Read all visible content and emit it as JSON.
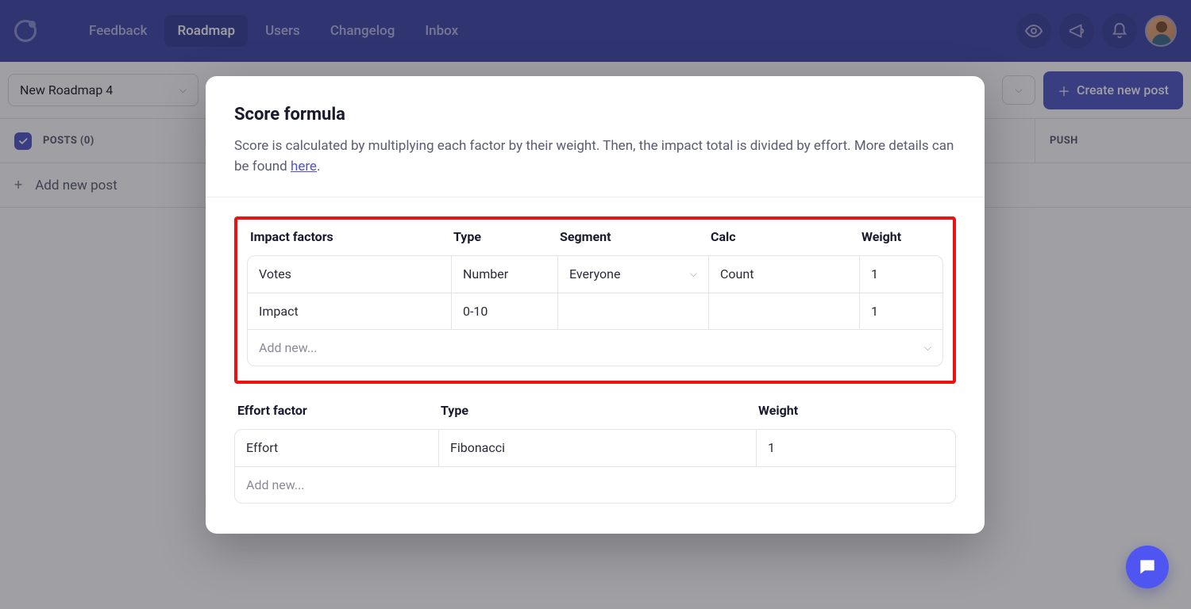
{
  "nav": {
    "items": [
      "Feedback",
      "Roadmap",
      "Users",
      "Changelog",
      "Inbox"
    ],
    "activeIndex": 1
  },
  "toolbar": {
    "roadmap_select": "New Roadmap 4",
    "create_post_label": "Create new post"
  },
  "board": {
    "posts_header": "POSTS (0)",
    "push_header": "PUSH",
    "add_post_label": "Add new post"
  },
  "modal": {
    "title": "Score formula",
    "description_prefix": "Score is calculated by multiplying each factor by their weight. Then, the impact total is divided by effort. More details can be found ",
    "description_link": "here",
    "description_suffix": ".",
    "impact": {
      "header_factor": "Impact factors",
      "header_type": "Type",
      "header_segment": "Segment",
      "header_calc": "Calc",
      "header_weight": "Weight",
      "rows": [
        {
          "name": "Votes",
          "type": "Number",
          "segment": "Everyone",
          "calc": "Count",
          "weight": "1"
        },
        {
          "name": "Impact",
          "type": "0-10",
          "segment": "",
          "calc": "",
          "weight": "1"
        }
      ],
      "add_new": "Add new..."
    },
    "effort": {
      "header_factor": "Effort factor",
      "header_type": "Type",
      "header_weight": "Weight",
      "rows": [
        {
          "name": "Effort",
          "type": "Fibonacci",
          "weight": "1"
        }
      ],
      "add_new": "Add new..."
    }
  }
}
